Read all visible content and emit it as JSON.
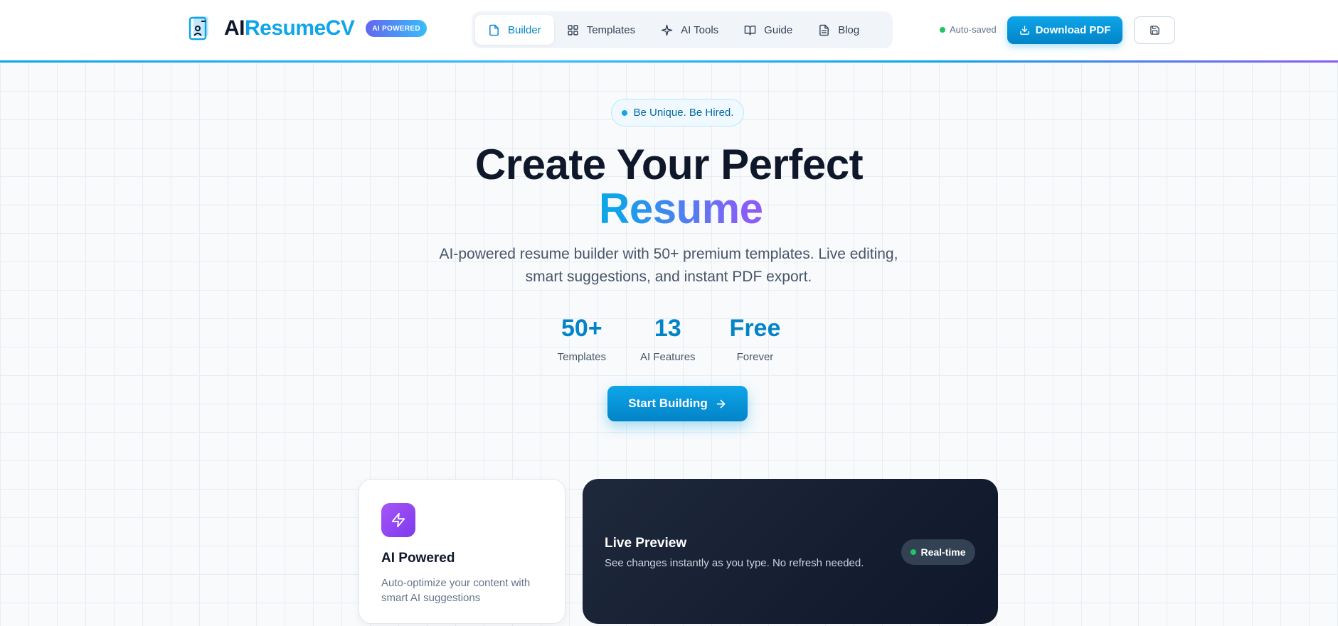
{
  "brand": {
    "name_part1": "AI",
    "name_part2": "ResumeCV",
    "badge": "AI POWERED"
  },
  "nav": {
    "items": [
      {
        "label": "Builder",
        "icon": "document-icon",
        "active": true
      },
      {
        "label": "Templates",
        "icon": "grid-icon",
        "active": false
      },
      {
        "label": "AI Tools",
        "icon": "sparkle-icon",
        "active": false
      },
      {
        "label": "Guide",
        "icon": "book-icon",
        "active": false
      },
      {
        "label": "Blog",
        "icon": "file-text-icon",
        "active": false
      }
    ]
  },
  "header": {
    "autosave": "Auto-saved",
    "download_label": "Download PDF"
  },
  "hero": {
    "tagline": "Be Unique. Be Hired.",
    "title_line1": "Create Your Perfect",
    "title_line2": "Resume",
    "subtitle": "AI-powered resume builder with 50+ premium templates. Live editing, smart suggestions, and instant PDF export.",
    "stats": [
      {
        "value": "50+",
        "label": "Templates"
      },
      {
        "value": "13",
        "label": "AI Features"
      },
      {
        "value": "Free",
        "label": "Forever"
      }
    ],
    "cta_label": "Start Building"
  },
  "features": {
    "ai": {
      "title": "AI Powered",
      "desc": "Auto-optimize your content with smart AI suggestions"
    },
    "live": {
      "title": "Live Preview",
      "desc": "See changes instantly as you type. No refresh needed.",
      "badge": "Real-time"
    }
  },
  "colors": {
    "accent": "#0ea5e9",
    "accent_dark": "#0284c7",
    "purple": "#8b5cf6",
    "dark_card": "#0f172a",
    "status_green": "#22c55e"
  }
}
